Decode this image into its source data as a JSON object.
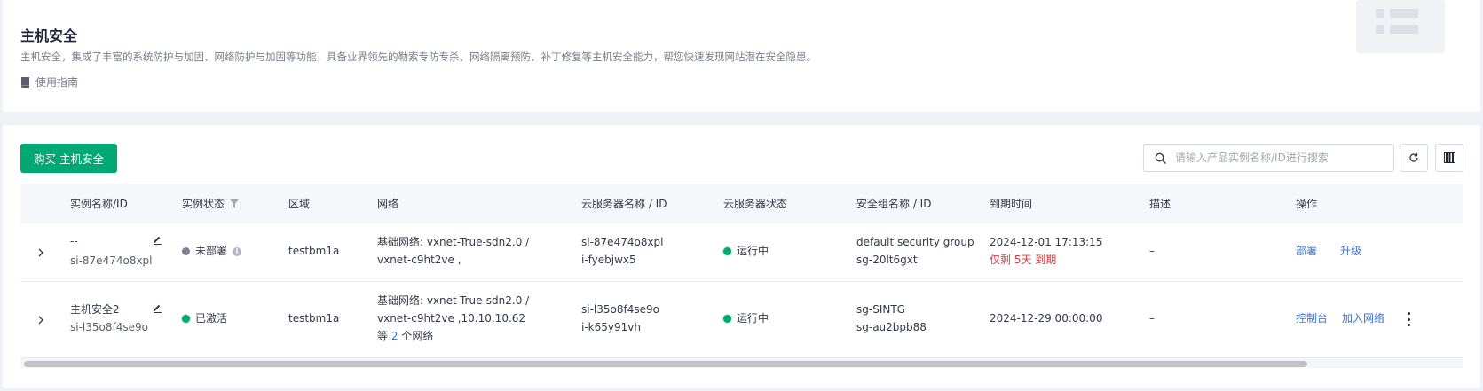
{
  "header": {
    "title": "主机安全",
    "description": "主机安全，集成了丰富的系统防护与加固、网络防护与加固等功能，具备业界领先的勒索专防专杀、网络隔离预防、补丁修复等主机安全能力，帮您快速发现网站潜在安全隐患。",
    "guide_link": "使用指南"
  },
  "toolbar": {
    "buy_button": "购买 主机安全",
    "search_placeholder": "请输入产品实例名称/ID进行搜索"
  },
  "table": {
    "columns": [
      "实例名称/ID",
      "实例状态",
      "区域",
      "网络",
      "云服务器名称 / ID",
      "云服务器状态",
      "安全组名称 / ID",
      "到期时间",
      "描述",
      "操作"
    ],
    "rows": [
      {
        "name": "--",
        "id": "si-87e474o8xpl",
        "status": "未部署",
        "status_color": "#7b8293",
        "region": "testbm1a",
        "network_line1": "基础网络: vxnet-True-sdn2.0 /",
        "network_line2": "vxnet-c9ht2ve ,",
        "server_name": "si-87e474o8xpl",
        "server_id": "i-fyebjwx5",
        "server_status": "运行中",
        "sg_name": "default security group",
        "sg_id": "sg-20lt6gxt",
        "expire_time": "2024-12-01 17:13:15",
        "expire_note": "仅剩 5天 到期",
        "description": "–",
        "actions": [
          "部署",
          "升级"
        ]
      },
      {
        "name": "主机安全2",
        "id": "si-l35o8f4se9o",
        "status": "已激活",
        "status_color": "#00a971",
        "region": "testbm1a",
        "network_line1": "基础网络: vxnet-True-sdn2.0 /",
        "network_line2": "vxnet-c9ht2ve ,10.10.10.62",
        "network_more_prefix": "等",
        "network_more_count": "2",
        "network_more_suffix": "个网络",
        "server_name": "si-l35o8f4se9o",
        "server_id": "i-k65y91vh",
        "server_status": "运行中",
        "sg_name": "sg-SINTG",
        "sg_id": "sg-au2bpb88",
        "expire_time": "2024-12-29 00:00:00",
        "description": "–",
        "actions": [
          "控制台",
          "加入网络"
        ]
      }
    ]
  },
  "colors": {
    "accent": "#00a971",
    "link": "#3b73d9",
    "danger": "#e0383e"
  },
  "icons": [
    "book-icon",
    "search-icon",
    "refresh-icon",
    "columns-icon",
    "filter-icon",
    "chevron-right-icon",
    "edit-icon",
    "info-icon",
    "more-vertical-icon"
  ]
}
